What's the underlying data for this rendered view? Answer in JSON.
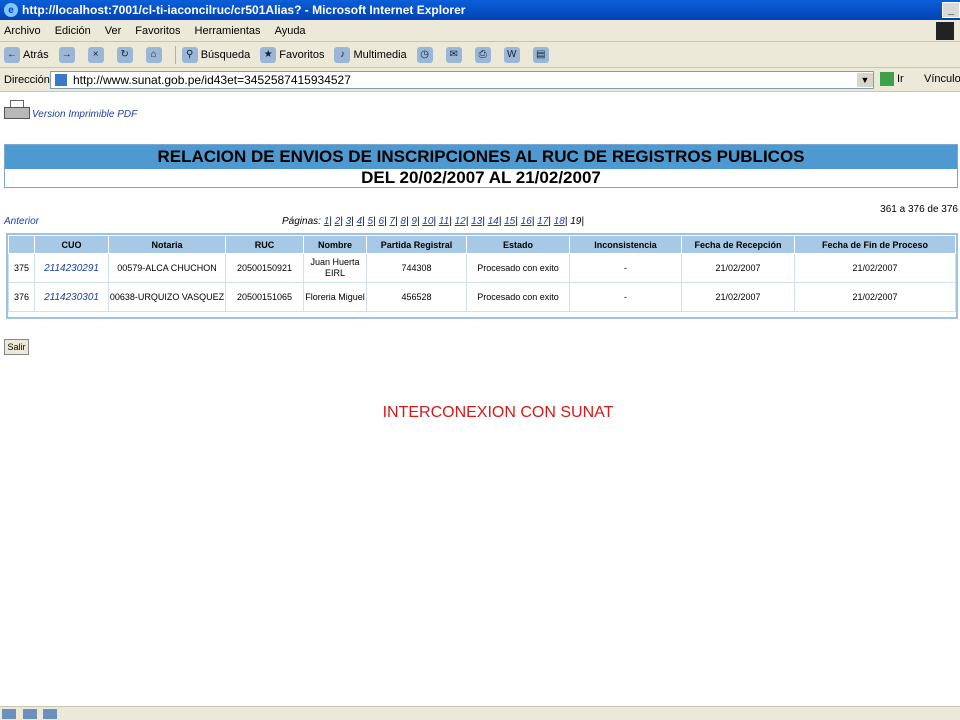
{
  "window": {
    "title": "http://localhost:7001/cl-ti-iaconcilruc/cr501Alias? - Microsoft Internet Explorer"
  },
  "menu": {
    "items": [
      "Archivo",
      "Edición",
      "Ver",
      "Favoritos",
      "Herramientas",
      "Ayuda"
    ]
  },
  "toolbar": {
    "back_label": "Atrás",
    "search_label": "Búsqueda",
    "favorites_label": "Favoritos",
    "multimedia_label": "Multimedia"
  },
  "address": {
    "label": "Dirección",
    "url": "http://www.sunat.gob.pe/id43et=3452587415934527",
    "go_label": "Ir",
    "links_label": "Vínculos"
  },
  "page": {
    "printable_label": "Version Imprimible PDF",
    "report_title": "RELACION DE ENVIOS DE INSCRIPCIONES AL RUC DE REGISTROS PUBLICOS",
    "report_subtitle": "DEL 20/02/2007 AL 21/02/2007",
    "anterior_label": "Anterior",
    "pages_label": "Páginas:",
    "pages": [
      "1",
      "2",
      "3",
      "4",
      "5",
      "6",
      "7",
      "8",
      "9",
      "10",
      "11",
      "12",
      "13",
      "14",
      "15",
      "16",
      "17",
      "18"
    ],
    "current_page": "19",
    "count_text": "361 a 376 de 376",
    "exit_label": "Salir",
    "caption": "INTERCONEXION CON SUNAT"
  },
  "table": {
    "headers": [
      "",
      "CUO",
      "Notaria",
      "RUC",
      "Nombre",
      "Partida Registral",
      "Estado",
      "Inconsistencia",
      "Fecha de Recepción",
      "Fecha de Fin de Proceso"
    ],
    "rows": [
      {
        "num": "375",
        "cuo": "2114230291",
        "notaria": "00579-ALCA CHUCHON",
        "ruc": "20500150921",
        "nombre": "Juan Huerta EIRL",
        "partida": "744308",
        "estado": "Procesado con exito",
        "inconsistencia": "-",
        "fecha_recepcion": "21/02/2007",
        "fecha_fin": "21/02/2007"
      },
      {
        "num": "376",
        "cuo": "2114230301",
        "notaria": "00638-URQUIZO VASQUEZ",
        "ruc": "20500151065",
        "nombre": "Floreria Miguel",
        "partida": "456528",
        "estado": "Procesado con exito",
        "inconsistencia": "-",
        "fecha_recepcion": "21/02/2007",
        "fecha_fin": "21/02/2007"
      }
    ]
  }
}
